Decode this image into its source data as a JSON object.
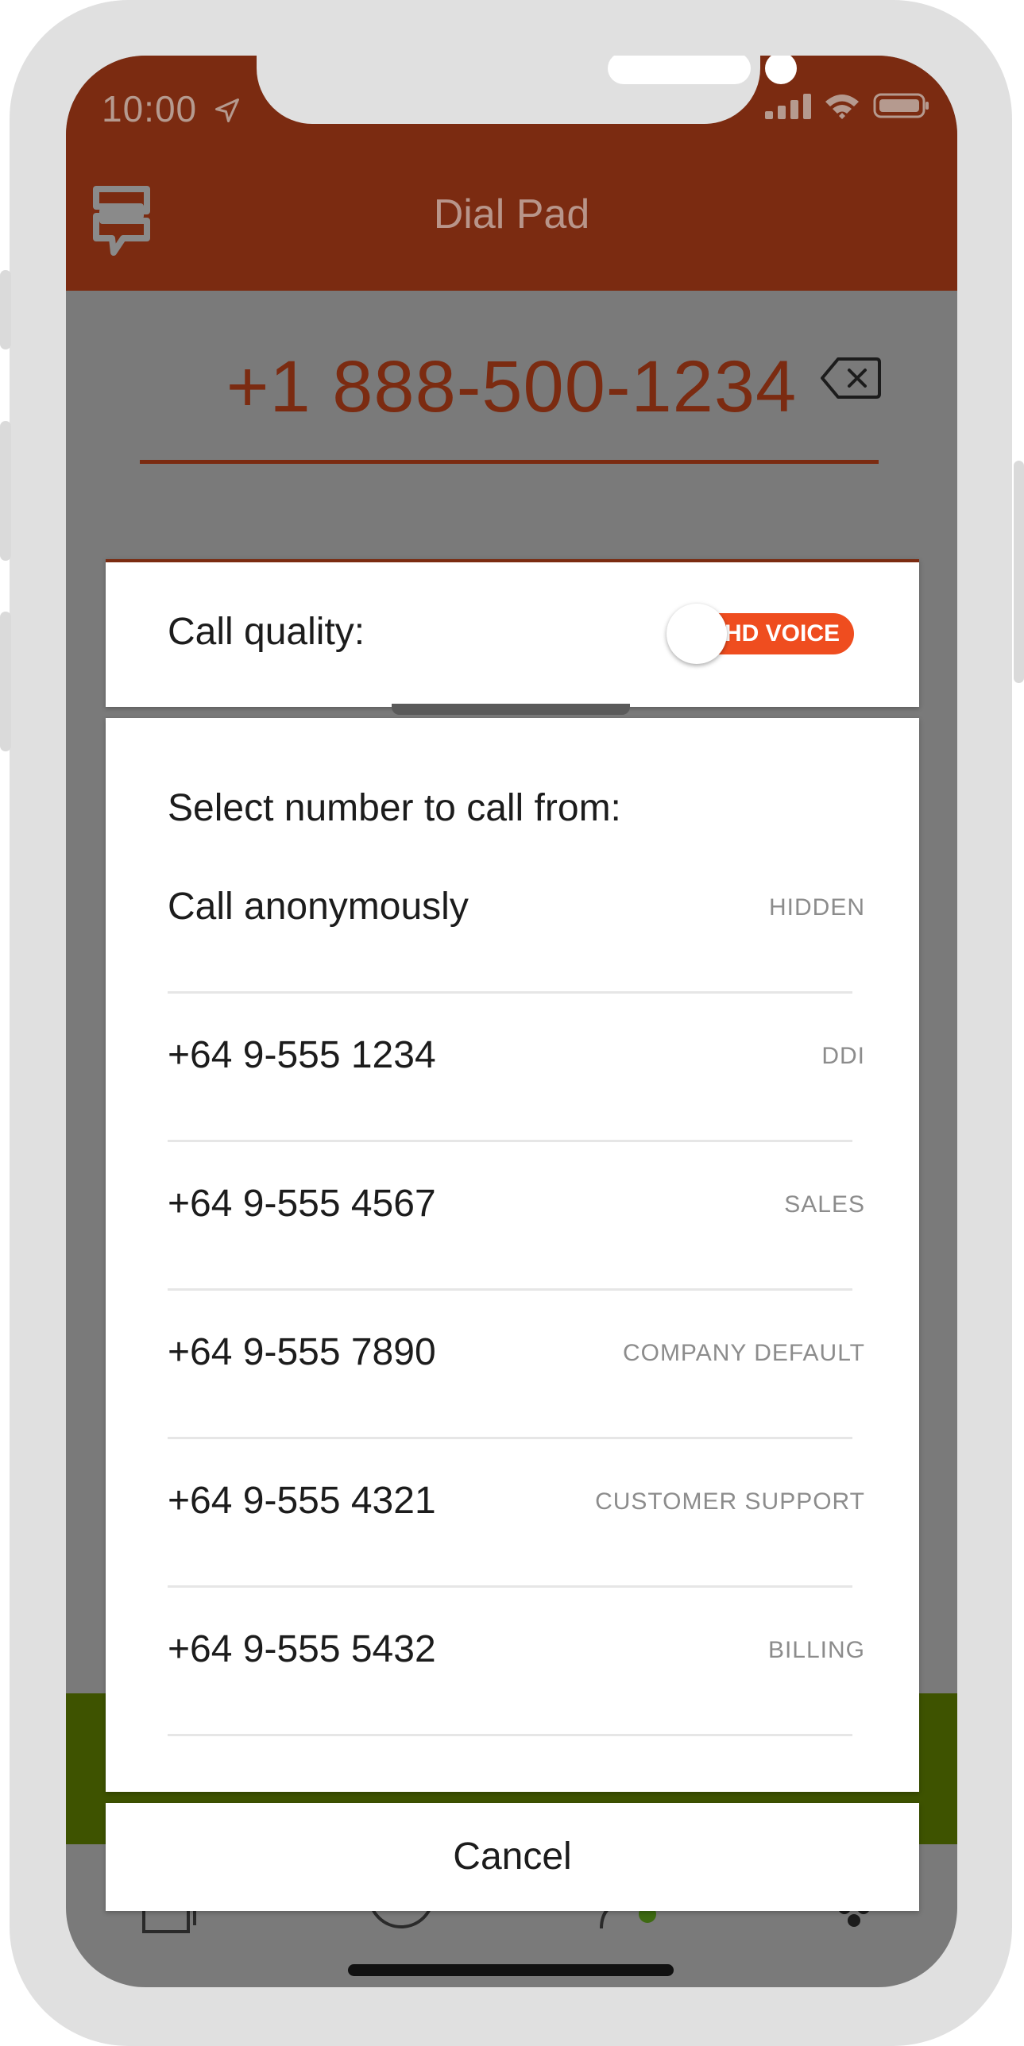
{
  "status_bar": {
    "time": "10:00"
  },
  "header": {
    "title": "Dial Pad"
  },
  "dialer": {
    "number": "+1 888-500-1234"
  },
  "call_quality": {
    "label": "Call quality:",
    "toggle_label": "HD VOICE",
    "enabled": true
  },
  "number_select": {
    "title": "Select number to call from:",
    "options": [
      {
        "number": "Call anonymously",
        "tag": "HIDDEN"
      },
      {
        "number": "+64 9-555 1234",
        "tag": "DDI"
      },
      {
        "number": "+64 9-555 4567",
        "tag": "SALES"
      },
      {
        "number": "+64 9-555 7890",
        "tag": "COMPANY DEFAULT"
      },
      {
        "number": "+64 9-555 4321",
        "tag": "CUSTOMER SUPPORT"
      },
      {
        "number": "+64 9-555 5432",
        "tag": "BILLING"
      }
    ]
  },
  "cancel": {
    "label": "Cancel"
  },
  "colors": {
    "brand": "#7b2b11",
    "accent": "#ef4d1f",
    "call_green": "#3e5300"
  }
}
